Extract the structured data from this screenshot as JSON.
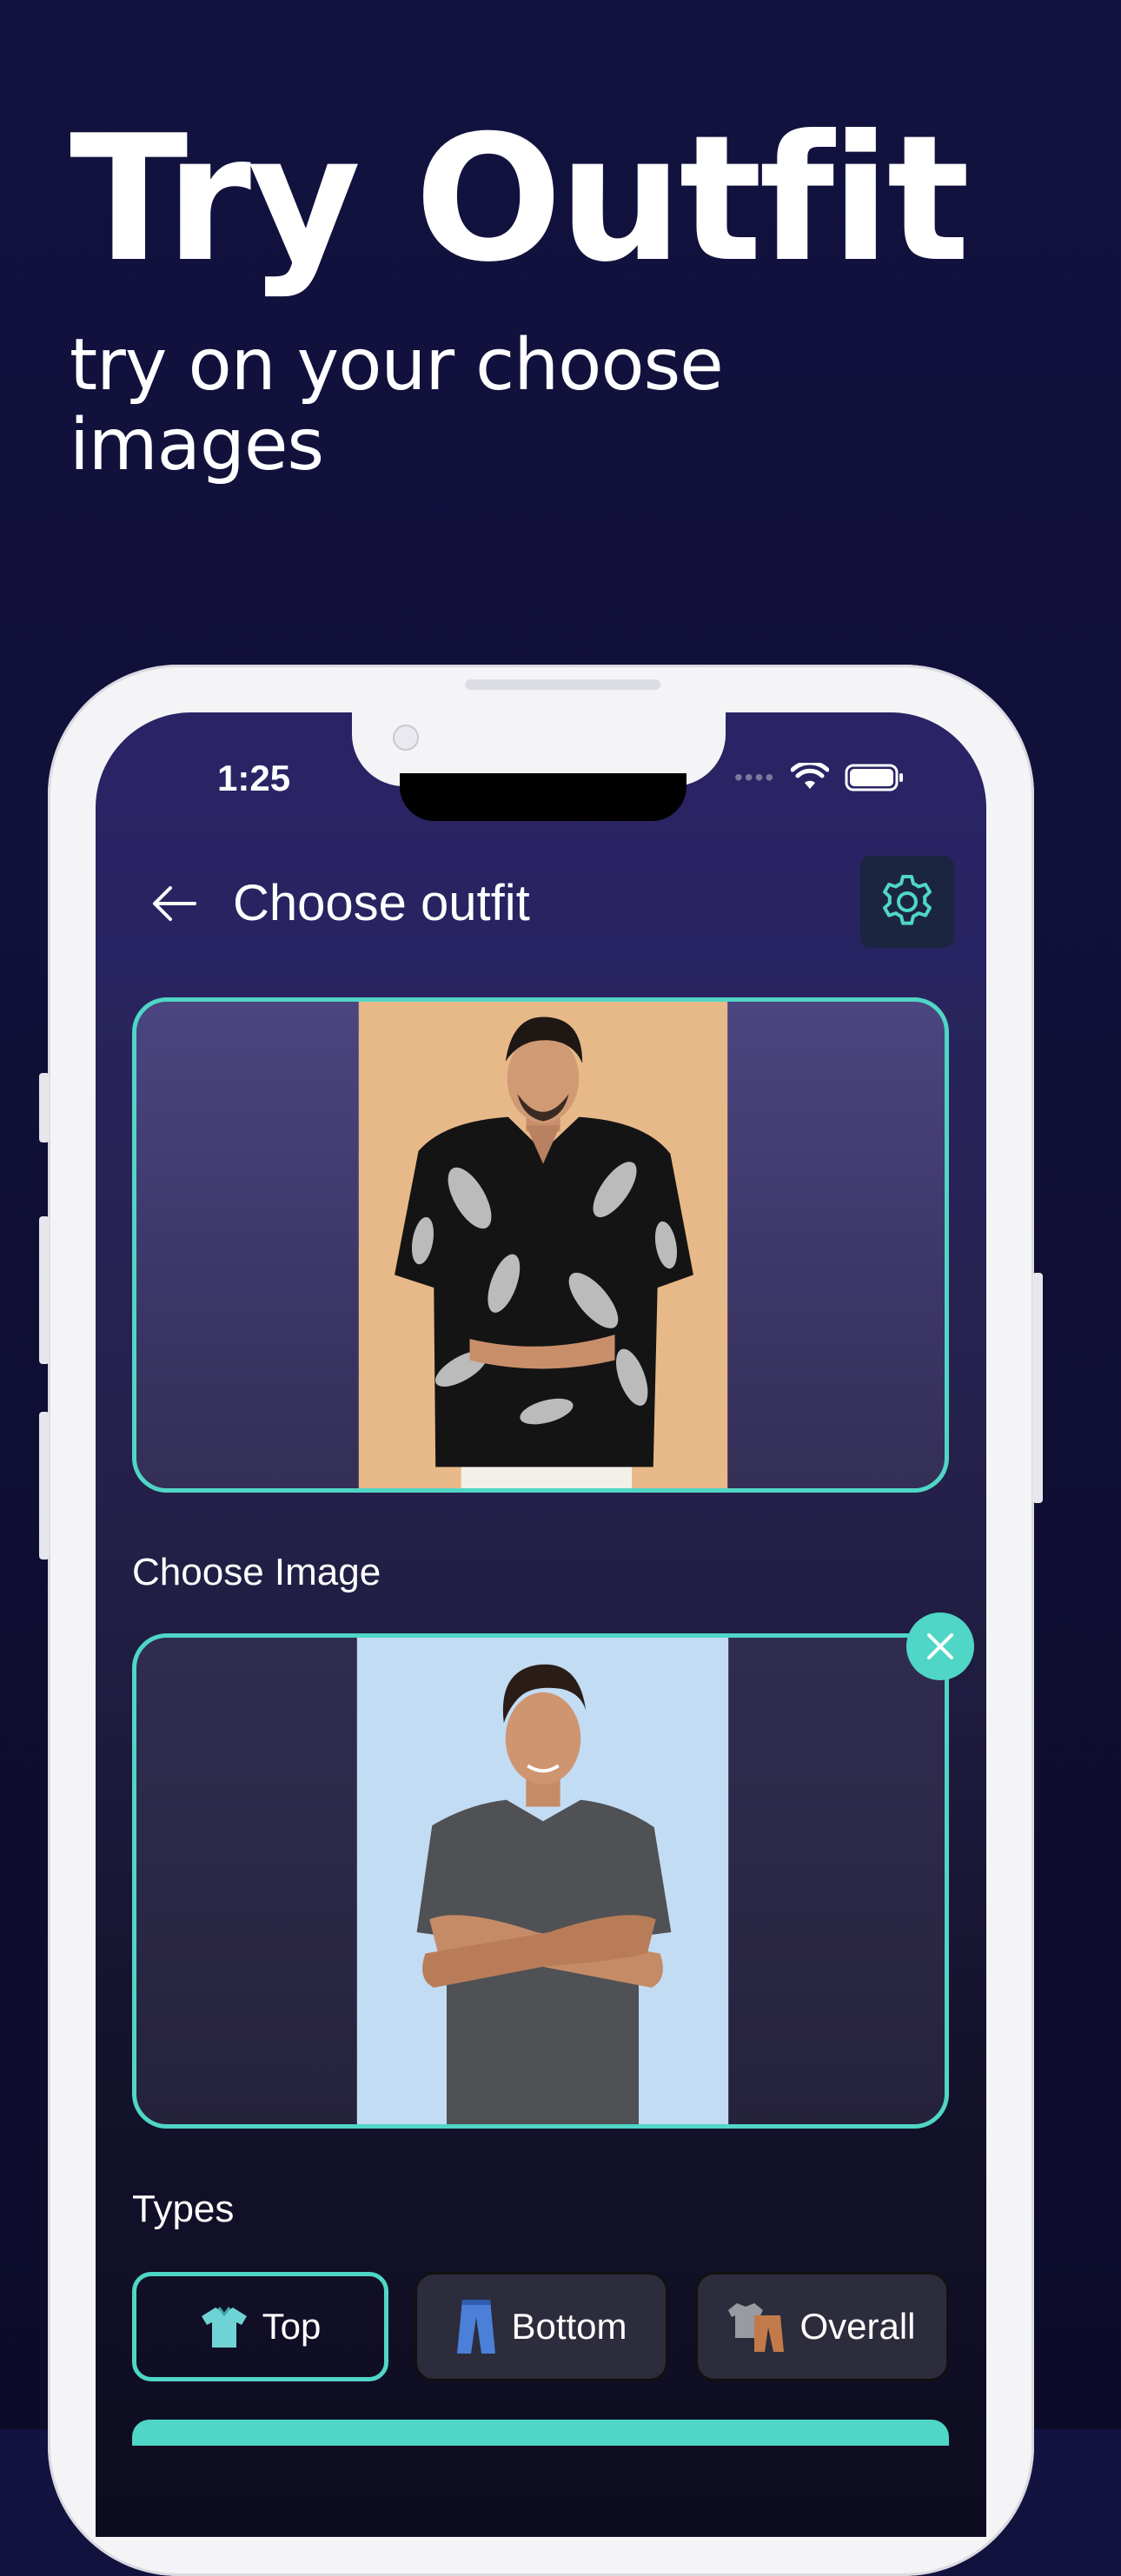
{
  "promo": {
    "headline": "Try Outfit",
    "subhead_line1": "try on your choose",
    "subhead_line2": "images"
  },
  "status_bar": {
    "time": "1:25"
  },
  "nav": {
    "title": "Choose outfit"
  },
  "sections": {
    "choose_image_label": "Choose Image",
    "types_label": "Types"
  },
  "types": [
    {
      "label": "Top",
      "selected": true
    },
    {
      "label": "Bottom",
      "selected": false
    },
    {
      "label": "Overall",
      "selected": false
    }
  ],
  "colors": {
    "accent": "#4fd6c6",
    "background": "#131240"
  }
}
